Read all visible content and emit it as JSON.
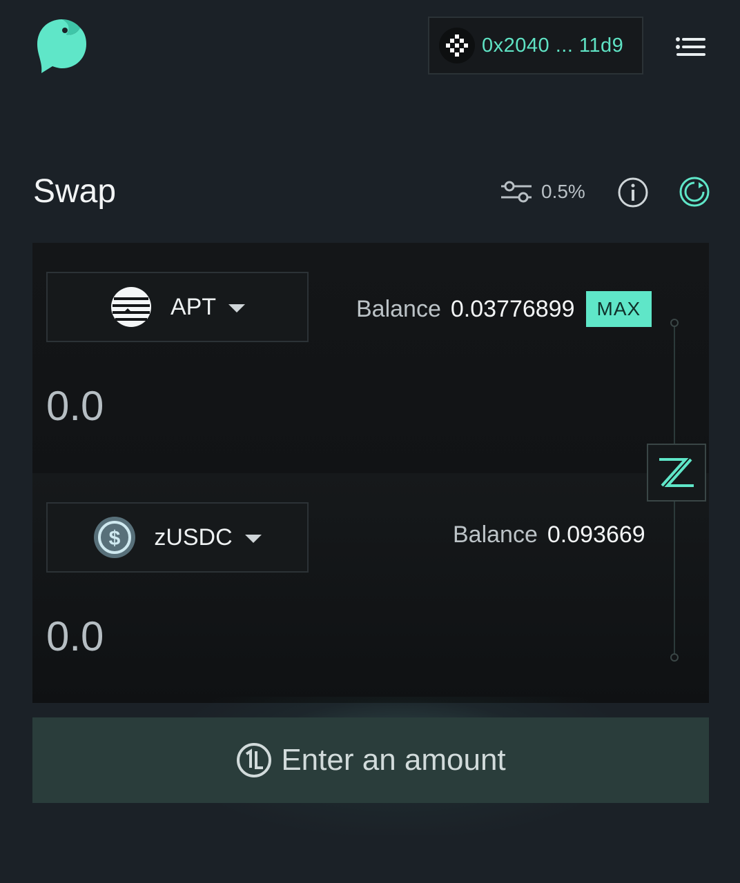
{
  "header": {
    "logo_icon": "bird-chat-logo-icon",
    "wallet": {
      "avatar_icon": "wallet-avatar-icon",
      "address": "0x2040 ... 11d9"
    },
    "menu_icon": "hamburger-menu-icon"
  },
  "swap": {
    "title": "Swap",
    "slippage": "0.5%",
    "settings_icon": "sliders-icon",
    "info_icon": "info-icon",
    "refresh_icon": "refresh-icon",
    "from": {
      "token": "APT",
      "token_icon": "aptos-token-icon",
      "balance_label": "Balance",
      "balance": "0.03776899",
      "max_label": "MAX",
      "amount_placeholder": "0.0"
    },
    "to": {
      "token": "zUSDC",
      "token_icon": "usdc-token-icon",
      "balance_label": "Balance",
      "balance": "0.093669",
      "amount_placeholder": "0.0"
    },
    "switch_icon": "swap-direction-icon",
    "action_label": "Enter an amount",
    "action_icon": "liquidswap-icon"
  },
  "colors": {
    "accent": "#5fe6c8",
    "background": "#1b2127",
    "panel": "#121416"
  }
}
